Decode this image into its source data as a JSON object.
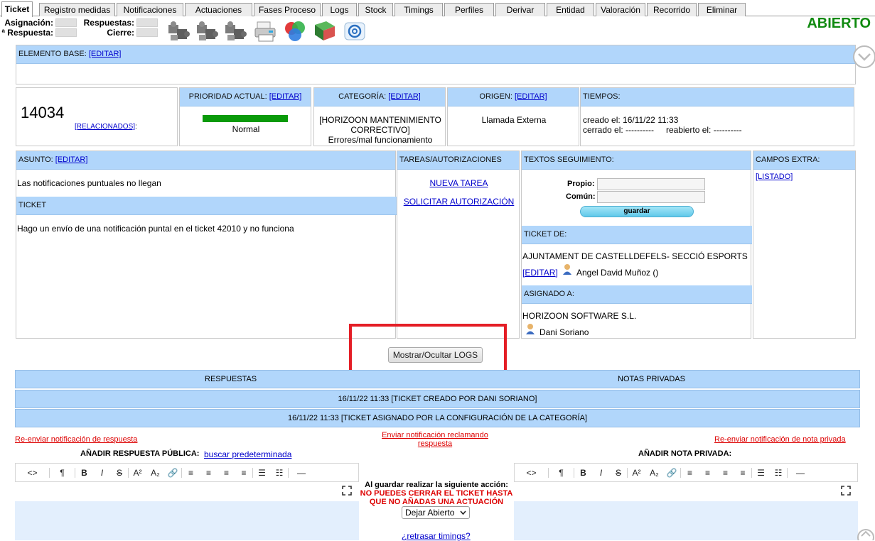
{
  "tabs": [
    "Ticket",
    "Registro medidas",
    "Notificaciones",
    "Actuaciones",
    "Fases Proceso",
    "Logs",
    "Stock",
    "Timings",
    "Perfiles",
    "Derivar",
    "Entidad",
    "Valoración",
    "Recorrido",
    "Eliminar"
  ],
  "summary": {
    "asignacion_label": "Asignación:",
    "respuestas_label": "Respuestas:",
    "primera_respuesta_label": "ª Respuesta:",
    "cierre_label": "Cierre:"
  },
  "toolbar_icons": [
    "puzzle-icon",
    "puzzle-icon",
    "puzzle-icon",
    "printer-icon",
    "color-balls-icon",
    "book-icon",
    "email-icon"
  ],
  "status": "ABIERTO",
  "elemento_base": {
    "label": "ELEMENTO BASE:",
    "edit": "[EDITAR]"
  },
  "ticket": {
    "number": "14034",
    "relacionados": "[RELACIONADOS]",
    "colon": ":"
  },
  "prioridad": {
    "label": "PRIORIDAD ACTUAL:",
    "edit": "[EDITAR]",
    "value": "Normal",
    "color": "#0a9a0a"
  },
  "categoria": {
    "label": "CATEGORÍA:",
    "edit": "[EDITAR]",
    "line1": "[HORIZOON MANTENIMIENTO",
    "line2": "CORRECTIVO]",
    "line3": "Errores/mal funcionamiento"
  },
  "origen": {
    "label": "ORIGEN:",
    "edit": "[EDITAR]",
    "value": "Llamada Externa"
  },
  "tiempos": {
    "label": "TIEMPOS:",
    "creado": "creado el: 16/11/22 11:33",
    "cerrado": "cerrado el: ----------",
    "reabierto": "reabierto el: ----------"
  },
  "asunto": {
    "label": "ASUNTO:",
    "edit": "[EDITAR]",
    "value": "Las notificaciones puntuales no llegan",
    "ticket_label": "TICKET",
    "ticket_text": "Hago un envío de una notificación puntal en el ticket 42010 y no funciona"
  },
  "tareas": {
    "label": "TAREAS/AUTORIZACIONES",
    "nueva": "NUEVA TAREA",
    "solicitar": "SOLICITAR AUTORIZACIÓN"
  },
  "textos": {
    "label": "TEXTOS SEGUIMIENTO:",
    "propio": "Propio:",
    "comun": "Común:",
    "guardar": "guardar",
    "ticket_de_label": "TICKET DE:",
    "ticket_de": "AJUNTAMENT DE CASTELLDEFELS- SECCIÓ ESPORTS",
    "editar": "[EDITAR]",
    "user1": "Angel David Muñoz ()",
    "asignado_label": "ASIGNADO A:",
    "asignado": "HORIZOON SOFTWARE S.L.",
    "user2": "Dani Soriano"
  },
  "campos": {
    "label": "CAMPOS EXTRA:",
    "listado": "[LISTADO]"
  },
  "logs_button": "Mostrar/Ocultar LOGS",
  "respuestas_header": "RESPUESTAS",
  "notas_header": "NOTAS PRIVADAS",
  "log1": "16/11/22 11:33  [TICKET CREADO POR DANI SORIANO]",
  "log2": "16/11/22 11:33  [TICKET ASIGNADO POR LA CONFIGURACIÓN DE LA CATEGORÍA]",
  "links": {
    "reenviar_respuesta": "Re-enviar notificación de respuesta",
    "reclamando_1": "Enviar notificación reclamando",
    "reclamando_2": "respuesta",
    "reenviar_nota": "Re-enviar notificación de nota privada"
  },
  "respuesta_publica": {
    "label": "AÑADIR RESPUESTA PÚBLICA:",
    "link": "buscar predeterminada"
  },
  "nota_privada": {
    "label": "AÑADIR NOTA PRIVADA:"
  },
  "editor_buttons": [
    "<>",
    "¶",
    "B",
    "I",
    "S",
    "A²",
    "A₂",
    "🔗",
    "≡",
    "≡",
    "≡",
    "≡",
    "☰",
    "☷",
    "—"
  ],
  "accion": {
    "label": "Al guardar realizar la siguiente acción:",
    "warn1": "NO PUEDES CERRAR EL TICKET HASTA",
    "warn2": "QUE NO AÑADAS UNA ACTUACIÓN",
    "select": "Dejar Abierto",
    "retrasar": "¿retrasar timings?"
  }
}
